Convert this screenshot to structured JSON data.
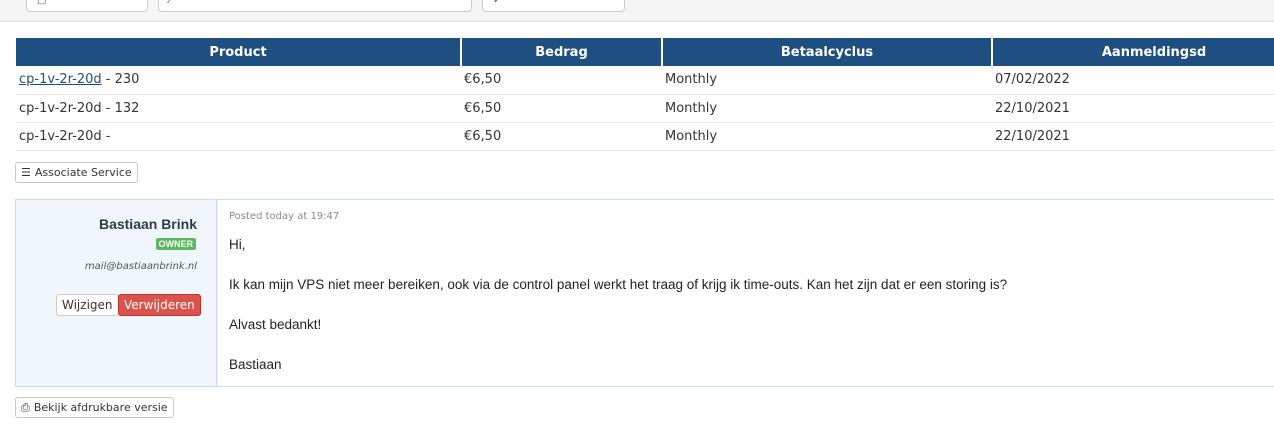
{
  "table": {
    "headers": [
      "Product",
      "Bedrag",
      "Betaalcyclus",
      "Aanmeldingsd"
    ],
    "rows": [
      {
        "product_link": "cp-1v-2r-20d",
        "product_suffix": " - 230",
        "amount": "€6,50",
        "cycle": "Monthly",
        "date": "07/02/2022"
      },
      {
        "product_link": "",
        "product_suffix": "cp-1v-2r-20d - 132",
        "amount": "€6,50",
        "cycle": "Monthly",
        "date": "22/10/2021"
      },
      {
        "product_link": "",
        "product_suffix": "cp-1v-2r-20d -",
        "amount": "€6,50",
        "cycle": "Monthly",
        "date": "22/10/2021"
      }
    ]
  },
  "associate_button": {
    "label": "Associate Service",
    "icon": "list-check-icon"
  },
  "reply": {
    "author": "Bastiaan Brink",
    "badge": "OWNER",
    "email": "mail@bastiaanbrink.nl",
    "edit_label": "Wijzigen",
    "delete_label": "Verwijderen",
    "posted": "Posted today at 19:47",
    "lines": [
      "Hi,",
      "Ik kan mijn VPS niet meer bereiken, ook via de control panel werkt het traag of krijg ik time-outs. Kan het zijn dat er een storing is?",
      "Alvast bedankt!",
      "Bastiaan"
    ]
  },
  "print_button": {
    "label": "Bekijk afdrukbare versie",
    "icon": "print-icon"
  },
  "colors": {
    "header_bg": "#1f4e80",
    "owner_badge": "#5cb85c",
    "delete_btn": "#d9534f",
    "reply_bg": "#f0f6fc"
  }
}
